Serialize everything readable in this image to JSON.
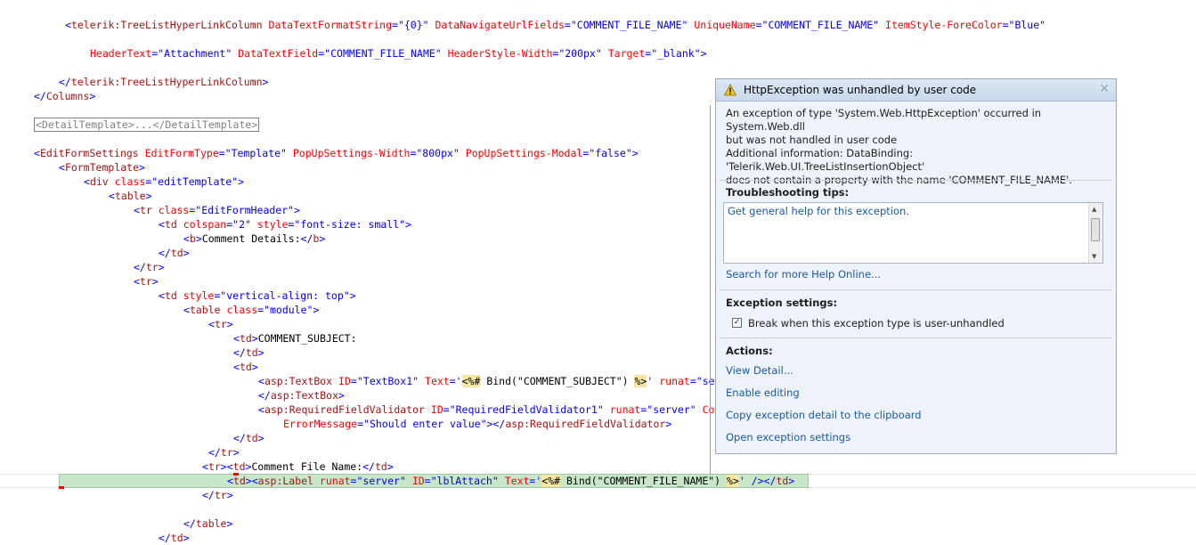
{
  "code": {
    "l1": {
      "open": "<",
      "tag": "telerik:TreeListHyperLinkColumn",
      "a1": "DataTextFormatString",
      "v1": "\"{0}\"",
      "a2": "DataNavigateUrlFields",
      "v2": "\"COMMENT_FILE_NAME\"",
      "a3": "UniqueName",
      "v3": "\"COMMENT_FILE_NAME\"",
      "a4": "ItemStyle-ForeColor",
      "v4": "\"Blue\""
    },
    "l2": {
      "a1": "HeaderText",
      "v1": "\"Attachment\"",
      "a2": "DataTextField",
      "v2": "\"COMMENT_FILE_NAME\"",
      "a3": "HeaderStyle-Width",
      "v3": "\"200px\"",
      "a4": "Target",
      "v4": "\"_blank\"",
      "close": ">"
    },
    "l3": {
      "open": "</",
      "tag": "telerik:TreeListHyperLinkColumn",
      "close": ">"
    },
    "l4": {
      "open": "</",
      "tag": "Columns",
      "close": ">"
    },
    "l5": {
      "collapsed": "<DetailTemplate>...</DetailTemplate>"
    },
    "l6": {
      "open": "<",
      "tag": "EditFormSettings",
      "a1": "EditFormType",
      "v1": "\"Template\"",
      "a2": "PopUpSettings-Width",
      "v2": "\"800px\"",
      "a3": "PopUpSettings-Modal",
      "v3": "\"false\"",
      "close": ">"
    },
    "l7": {
      "open": "<",
      "tag": "FormTemplate",
      "close": ">"
    },
    "l8": {
      "open": "<",
      "tag": "div",
      "a1": "class",
      "v1": "\"editTemplate\"",
      "close": ">"
    },
    "l9": {
      "open": "<",
      "tag": "table",
      "close": ">"
    },
    "l10": {
      "open": "<",
      "tag": "tr",
      "a1": "class",
      "v1": "\"EditFormHeader\"",
      "close": ">"
    },
    "l11": {
      "open": "<",
      "tag": "td",
      "a1": "colspan",
      "v1": "\"2\"",
      "a2": "style",
      "v2": "\"font-size: small\"",
      "close": ">"
    },
    "l12": {
      "open": "<",
      "tag": "b",
      "close1": ">",
      "text": "Comment Details:",
      "open2": "</",
      "tag2": "b",
      "close2": ">"
    },
    "l13": {
      "open": "</",
      "tag": "td",
      "close": ">"
    },
    "l14": {
      "open": "</",
      "tag": "tr",
      "close": ">"
    },
    "l15": {
      "open": "<",
      "tag": "tr",
      "close": ">"
    },
    "l16": {
      "open": "<",
      "tag": "td",
      "a1": "style",
      "v1": "\"vertical-align: top\"",
      "close": ">"
    },
    "l17": {
      "open": "<",
      "tag": "table",
      "a1": "class",
      "v1": "\"module\"",
      "close": ">"
    },
    "l18": {
      "open": "<",
      "tag": "tr",
      "close": ">"
    },
    "l19": {
      "open": "<",
      "tag": "td",
      "close": ">",
      "text": "COMMENT_SUBJECT:"
    },
    "l20": {
      "open": "</",
      "tag": "td",
      "close": ">"
    },
    "l21": {
      "open": "<",
      "tag": "td",
      "close": ">"
    },
    "l22": {
      "open": "<",
      "tag": "asp:TextBox",
      "a1": "ID",
      "v1": "\"TextBox1\"",
      "a2": "Text",
      "v2": "'",
      "d1": "<%#",
      "expr": " Bind(\"COMMENT_SUBJECT\") ",
      "d2": "%>",
      "v2b": "'",
      "a3": "runat",
      "v3": "\"se"
    },
    "l23": {
      "open": "</",
      "tag": "asp:TextBox",
      "close": ">"
    },
    "l24": {
      "open": "<",
      "tag": "asp:RequiredFieldValidator",
      "a1": "ID",
      "v1": "\"RequiredFieldValidator1\"",
      "a2": "runat",
      "v2": "\"server\"",
      "a3": "Co"
    },
    "l25": {
      "a1": "ErrorMessage",
      "v1": "\"Should enter value\"",
      "close1": ">",
      "open2": "</",
      "tag2": "asp:RequiredFieldValidator",
      "close2": ">"
    },
    "l26": {
      "open": "</",
      "tag": "td",
      "close": ">"
    },
    "l27": {
      "open": "</",
      "tag": "tr",
      "close": ">"
    },
    "l28": {
      "open": "<",
      "tag": "tr",
      "close": ">",
      "open2": "<",
      "tag2": "td",
      "close2": ">",
      "text": "Comment File Name:",
      "open3": "</",
      "tag3": "td",
      "close3": ">"
    },
    "l29": {
      "open": "<",
      "tag": "td",
      "close": ">",
      "open2": "<",
      "tag2": "asp:Label",
      "a1": "runat",
      "v1": "\"server\"",
      "a2": "ID",
      "v2": "\"lblAttach\"",
      "a3": "Text",
      "v3": "'",
      "d1": "<%#",
      "expr": " Bind(\"COMMENT_FILE_NAME\") ",
      "d2": "%>",
      "v3b": "'",
      "close3": " />",
      "open4": "</",
      "tag4": "td",
      "close4": ">"
    },
    "l30": {
      "open": "</",
      "tag": "tr",
      "close": ">"
    },
    "l31": {
      "open": "</",
      "tag": "table",
      "close": ">"
    },
    "l32": {
      "open": "</",
      "tag": "td",
      "close": ">"
    }
  },
  "exception": {
    "title": "HttpException was unhandled by user code",
    "message_line1": "An exception of type 'System.Web.HttpException' occurred in System.Web.dll",
    "message_line2": "but was not handled in user code",
    "info_line1": "Additional information: DataBinding: 'Telerik.Web.UI.TreeListInsertionObject'",
    "info_line2": "does not contain a property with the name 'COMMENT_FILE_NAME'.",
    "tips_header": "Troubleshooting tips:",
    "tips_link": "Get general help for this exception.",
    "search_link": "Search for more Help Online...",
    "settings_header": "Exception settings:",
    "checkbox_label": "Break when this exception type is user-unhandled",
    "checkbox_checked": true,
    "actions_header": "Actions:",
    "actions": [
      "View Detail...",
      "Enable editing",
      "Copy exception detail to the clipboard",
      "Open exception settings"
    ]
  },
  "colors": {
    "tag": "#a31515",
    "attribute": "#ff0000",
    "value": "#0000ff",
    "link": "#1a5aa8",
    "highlight": "#c8e6c9"
  },
  "icons": [
    "warning-icon",
    "close-icon",
    "scroll-up-icon",
    "scroll-down-icon",
    "checkmark-icon"
  ]
}
